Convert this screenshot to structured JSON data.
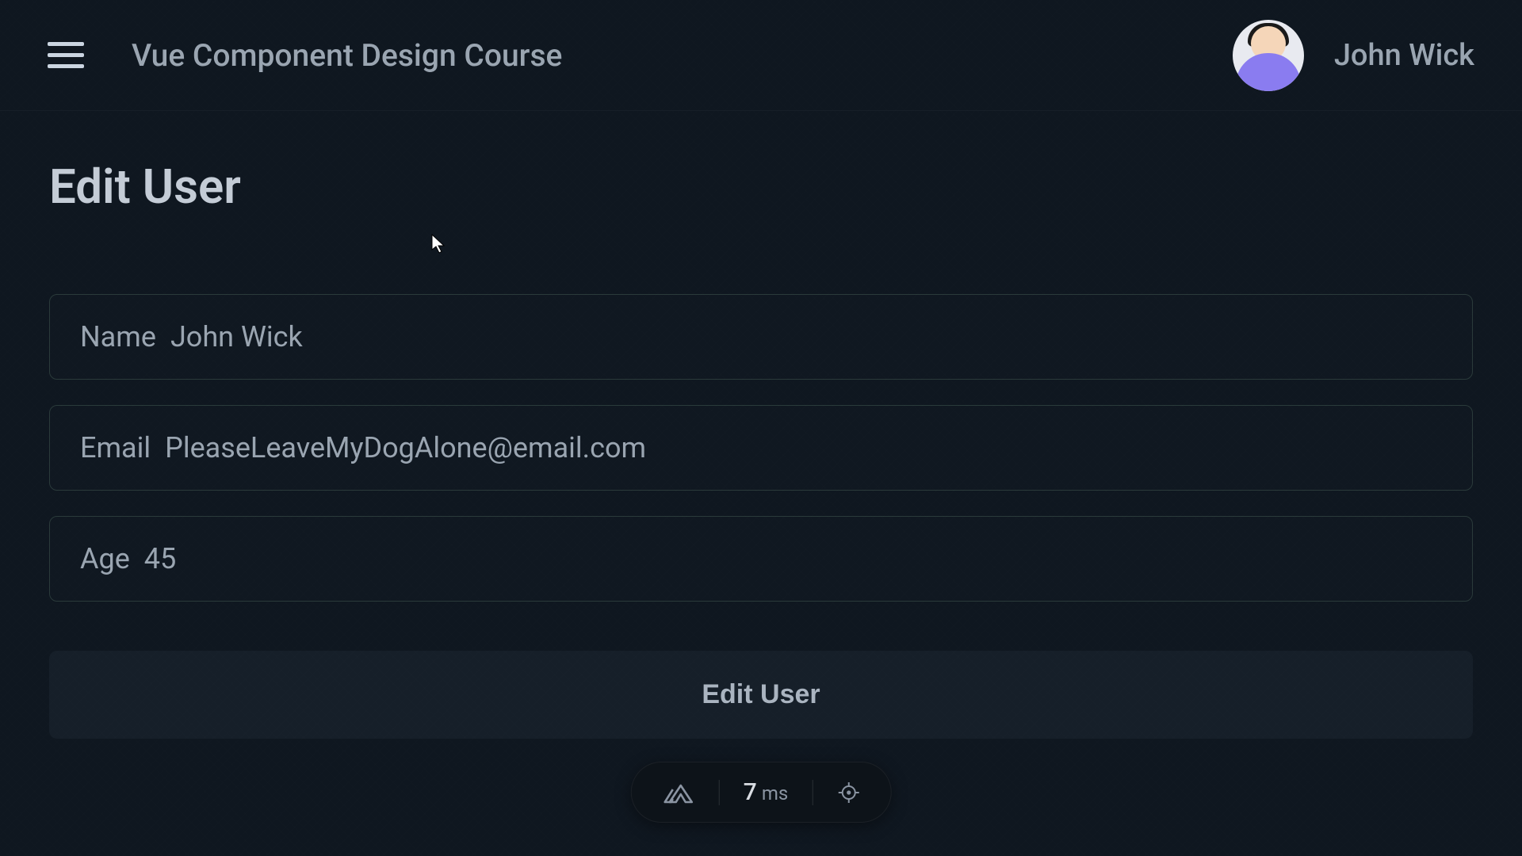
{
  "header": {
    "app_title": "Vue Component Design Course",
    "user_name": "John Wick"
  },
  "page": {
    "title": "Edit User"
  },
  "form": {
    "fields": [
      {
        "label": "Name",
        "value": "John Wick"
      },
      {
        "label": "Email",
        "value": "PleaseLeaveMyDogAlone@email.com"
      },
      {
        "label": "Age",
        "value": "45"
      }
    ],
    "submit_label": "Edit User"
  },
  "devtools": {
    "timing_value": "7",
    "timing_unit": "ms"
  }
}
